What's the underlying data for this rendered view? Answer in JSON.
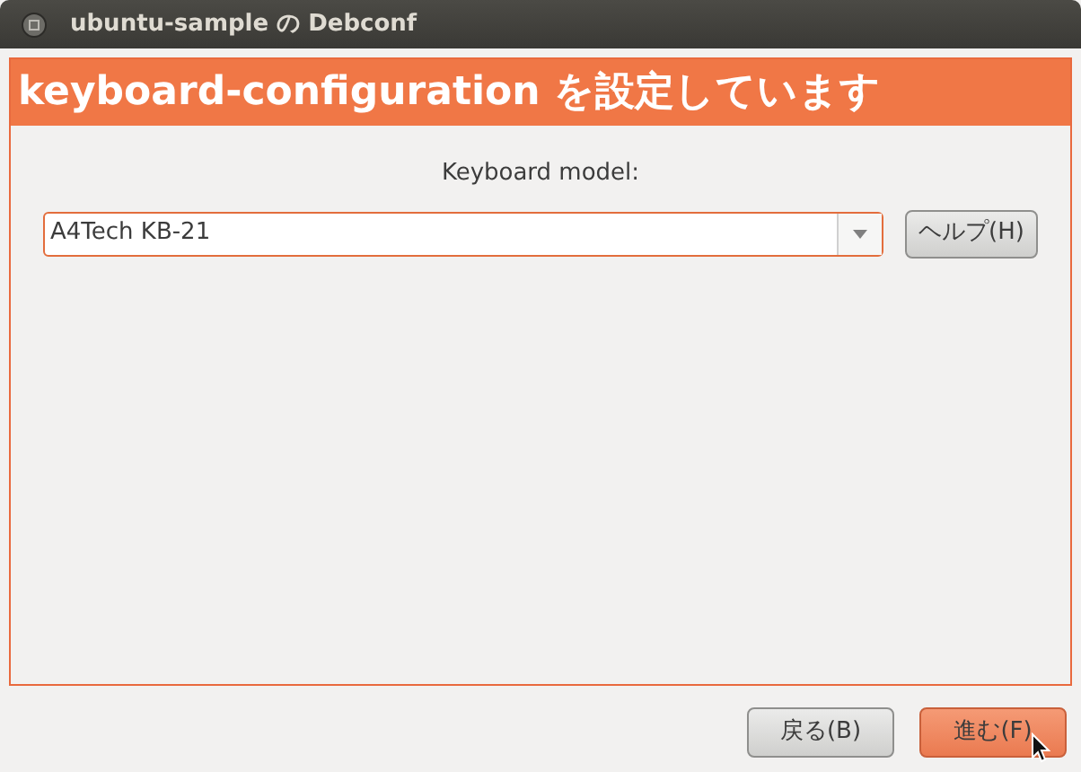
{
  "window": {
    "title": "ubuntu-sample の Debconf"
  },
  "header": "keyboard-configuration を設定しています",
  "field": {
    "label": "Keyboard model:",
    "value": "A4Tech KB-21"
  },
  "help_button": "ヘルプ(H)",
  "buttons": [
    {
      "label": "戻る(B)",
      "default": false
    },
    {
      "label": "進む(F)",
      "default": true
    }
  ]
}
